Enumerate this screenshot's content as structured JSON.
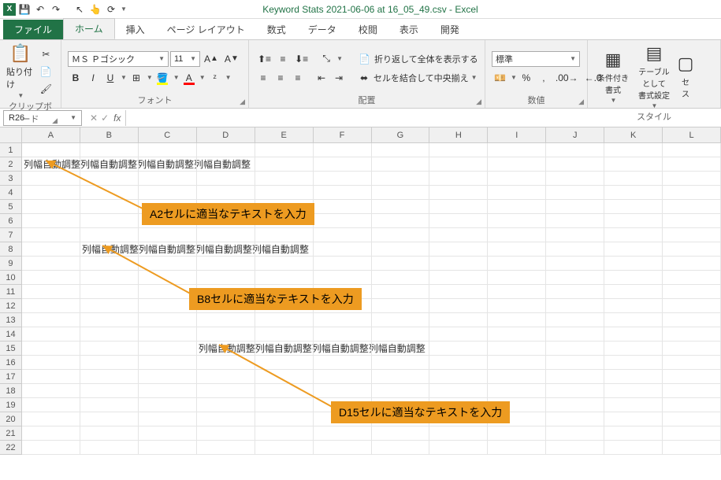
{
  "title": "Keyword Stats 2021-06-06 at 16_05_49.csv - Excel",
  "qat": {
    "save": "💾",
    "undo": "↶",
    "redo": "↷",
    "cursor": "↖",
    "touch": "👆",
    "refresh": "⟳"
  },
  "tabs": {
    "file": "ファイル",
    "items": [
      "ホーム",
      "挿入",
      "ページ レイアウト",
      "数式",
      "データ",
      "校閲",
      "表示",
      "開発"
    ],
    "active": 0
  },
  "ribbon": {
    "clipboard": {
      "label": "クリップボード",
      "paste": "貼り付け"
    },
    "font": {
      "label": "フォント",
      "name": "ＭＳ Ｐゴシック",
      "size": "11",
      "bold": "B",
      "italic": "I",
      "underline": "U"
    },
    "align": {
      "label": "配置",
      "wrap": "折り返して全体を表示する",
      "merge": "セルを結合して中央揃え"
    },
    "number": {
      "label": "数値",
      "format": "標準",
      "percent": "%",
      "comma": ","
    },
    "styles": {
      "label": "スタイル",
      "cond": "条件付き\n書式",
      "table": "テーブルとして\n書式設定",
      "cell": "セ\nス"
    }
  },
  "namebox": "R26",
  "columns": [
    "A",
    "B",
    "C",
    "D",
    "E",
    "F",
    "G",
    "H",
    "I",
    "J",
    "K",
    "L"
  ],
  "rowcount": 22,
  "cells": {
    "A2": "列幅自動調整列幅自動調整列幅自動調整列幅自動調整",
    "B8": "列幅自動調整列幅自動調整列幅自動調整列幅自動調整",
    "D15": "列幅自動調整列幅自動調整列幅自動調整列幅自動調整"
  },
  "callouts": {
    "a2": "A2セルに適当なテキストを入力",
    "b8": "B8セルに適当なテキストを入力",
    "d15": "D15セルに適当なテキストを入力"
  }
}
